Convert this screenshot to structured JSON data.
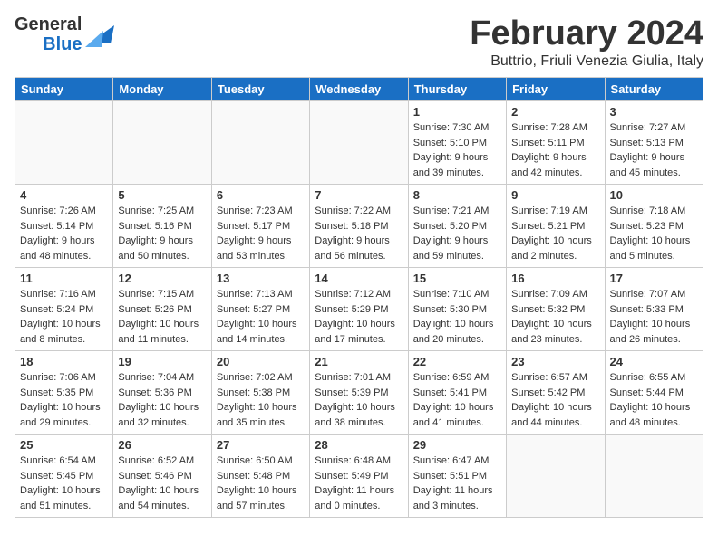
{
  "header": {
    "logo_general": "General",
    "logo_blue": "Blue",
    "title": "February 2024",
    "location": "Buttrio, Friuli Venezia Giulia, Italy"
  },
  "weekdays": [
    "Sunday",
    "Monday",
    "Tuesday",
    "Wednesday",
    "Thursday",
    "Friday",
    "Saturday"
  ],
  "weeks": [
    [
      {
        "day": "",
        "info": ""
      },
      {
        "day": "",
        "info": ""
      },
      {
        "day": "",
        "info": ""
      },
      {
        "day": "",
        "info": ""
      },
      {
        "day": "1",
        "info": "Sunrise: 7:30 AM\nSunset: 5:10 PM\nDaylight: 9 hours\nand 39 minutes."
      },
      {
        "day": "2",
        "info": "Sunrise: 7:28 AM\nSunset: 5:11 PM\nDaylight: 9 hours\nand 42 minutes."
      },
      {
        "day": "3",
        "info": "Sunrise: 7:27 AM\nSunset: 5:13 PM\nDaylight: 9 hours\nand 45 minutes."
      }
    ],
    [
      {
        "day": "4",
        "info": "Sunrise: 7:26 AM\nSunset: 5:14 PM\nDaylight: 9 hours\nand 48 minutes."
      },
      {
        "day": "5",
        "info": "Sunrise: 7:25 AM\nSunset: 5:16 PM\nDaylight: 9 hours\nand 50 minutes."
      },
      {
        "day": "6",
        "info": "Sunrise: 7:23 AM\nSunset: 5:17 PM\nDaylight: 9 hours\nand 53 minutes."
      },
      {
        "day": "7",
        "info": "Sunrise: 7:22 AM\nSunset: 5:18 PM\nDaylight: 9 hours\nand 56 minutes."
      },
      {
        "day": "8",
        "info": "Sunrise: 7:21 AM\nSunset: 5:20 PM\nDaylight: 9 hours\nand 59 minutes."
      },
      {
        "day": "9",
        "info": "Sunrise: 7:19 AM\nSunset: 5:21 PM\nDaylight: 10 hours\nand 2 minutes."
      },
      {
        "day": "10",
        "info": "Sunrise: 7:18 AM\nSunset: 5:23 PM\nDaylight: 10 hours\nand 5 minutes."
      }
    ],
    [
      {
        "day": "11",
        "info": "Sunrise: 7:16 AM\nSunset: 5:24 PM\nDaylight: 10 hours\nand 8 minutes."
      },
      {
        "day": "12",
        "info": "Sunrise: 7:15 AM\nSunset: 5:26 PM\nDaylight: 10 hours\nand 11 minutes."
      },
      {
        "day": "13",
        "info": "Sunrise: 7:13 AM\nSunset: 5:27 PM\nDaylight: 10 hours\nand 14 minutes."
      },
      {
        "day": "14",
        "info": "Sunrise: 7:12 AM\nSunset: 5:29 PM\nDaylight: 10 hours\nand 17 minutes."
      },
      {
        "day": "15",
        "info": "Sunrise: 7:10 AM\nSunset: 5:30 PM\nDaylight: 10 hours\nand 20 minutes."
      },
      {
        "day": "16",
        "info": "Sunrise: 7:09 AM\nSunset: 5:32 PM\nDaylight: 10 hours\nand 23 minutes."
      },
      {
        "day": "17",
        "info": "Sunrise: 7:07 AM\nSunset: 5:33 PM\nDaylight: 10 hours\nand 26 minutes."
      }
    ],
    [
      {
        "day": "18",
        "info": "Sunrise: 7:06 AM\nSunset: 5:35 PM\nDaylight: 10 hours\nand 29 minutes."
      },
      {
        "day": "19",
        "info": "Sunrise: 7:04 AM\nSunset: 5:36 PM\nDaylight: 10 hours\nand 32 minutes."
      },
      {
        "day": "20",
        "info": "Sunrise: 7:02 AM\nSunset: 5:38 PM\nDaylight: 10 hours\nand 35 minutes."
      },
      {
        "day": "21",
        "info": "Sunrise: 7:01 AM\nSunset: 5:39 PM\nDaylight: 10 hours\nand 38 minutes."
      },
      {
        "day": "22",
        "info": "Sunrise: 6:59 AM\nSunset: 5:41 PM\nDaylight: 10 hours\nand 41 minutes."
      },
      {
        "day": "23",
        "info": "Sunrise: 6:57 AM\nSunset: 5:42 PM\nDaylight: 10 hours\nand 44 minutes."
      },
      {
        "day": "24",
        "info": "Sunrise: 6:55 AM\nSunset: 5:44 PM\nDaylight: 10 hours\nand 48 minutes."
      }
    ],
    [
      {
        "day": "25",
        "info": "Sunrise: 6:54 AM\nSunset: 5:45 PM\nDaylight: 10 hours\nand 51 minutes."
      },
      {
        "day": "26",
        "info": "Sunrise: 6:52 AM\nSunset: 5:46 PM\nDaylight: 10 hours\nand 54 minutes."
      },
      {
        "day": "27",
        "info": "Sunrise: 6:50 AM\nSunset: 5:48 PM\nDaylight: 10 hours\nand 57 minutes."
      },
      {
        "day": "28",
        "info": "Sunrise: 6:48 AM\nSunset: 5:49 PM\nDaylight: 11 hours\nand 0 minutes."
      },
      {
        "day": "29",
        "info": "Sunrise: 6:47 AM\nSunset: 5:51 PM\nDaylight: 11 hours\nand 3 minutes."
      },
      {
        "day": "",
        "info": ""
      },
      {
        "day": "",
        "info": ""
      }
    ]
  ]
}
